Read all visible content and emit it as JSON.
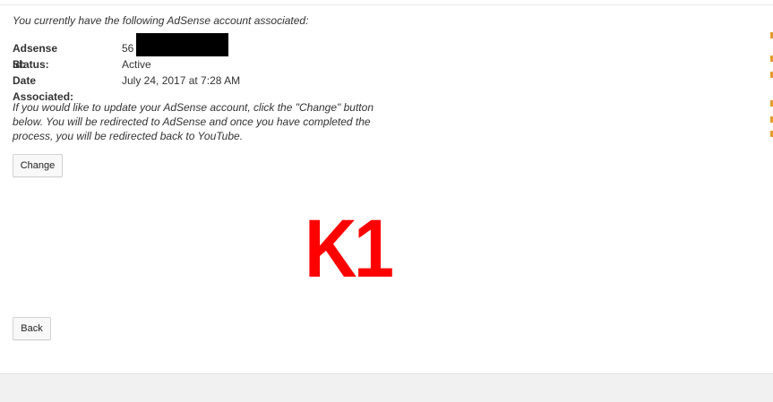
{
  "intro_text": "You currently have the following AdSense account associated:",
  "account": {
    "fields": [
      {
        "label": "Adsense Id:",
        "value": "56"
      },
      {
        "label": "Status:",
        "value": "Active"
      },
      {
        "label": "Date Associated:",
        "value": "July 24, 2017 at 7:28 AM"
      }
    ]
  },
  "note_text": "If you would like to update your AdSense account, click the \"Change\" button below. You will be redirected to AdSense and once you have completed the process, you will be redirected back to YouTube.",
  "buttons": {
    "change_label": "Change",
    "back_label": "Back"
  },
  "watermark_text": "K1",
  "colors": {
    "watermark": "#ff0000",
    "redaction": "#000000",
    "edge_accent": "#e69a2a"
  }
}
